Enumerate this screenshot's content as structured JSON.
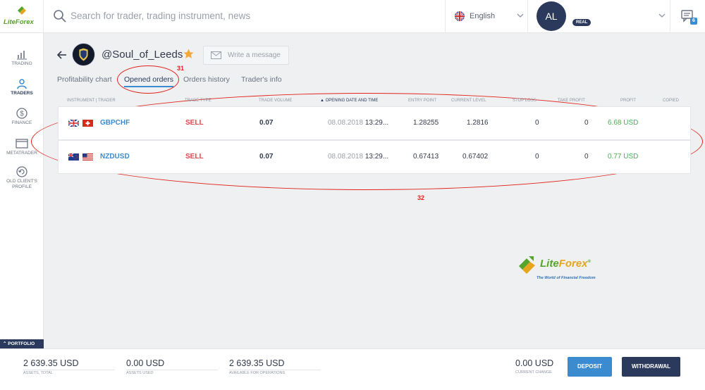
{
  "header": {
    "brand": "LiteForex",
    "search_placeholder": "Search for trader, trading instrument, news",
    "language": "English",
    "user_initials": "AL",
    "account_type": "REAL",
    "messages_count": "6"
  },
  "sidebar": {
    "items": [
      {
        "label": "TRADING",
        "icon": "chart-icon"
      },
      {
        "label": "TRADERS",
        "icon": "traders-icon"
      },
      {
        "label": "FINANCE",
        "icon": "dollar-icon"
      },
      {
        "label": "METATRADER",
        "icon": "window-icon"
      },
      {
        "label": "OLD CLIENT'S PROFILE",
        "icon": "refresh-icon"
      }
    ],
    "portfolio_label": "PORTFOLIO"
  },
  "trader": {
    "name": "@Soul_of_Leeds",
    "write_message": "Write a message"
  },
  "tabs": [
    {
      "label": "Profitability chart"
    },
    {
      "label": "Opened orders"
    },
    {
      "label": "Orders history"
    },
    {
      "label": "Trader's info"
    }
  ],
  "annotations": {
    "tab": "31",
    "table": "32"
  },
  "table": {
    "headers": [
      "INSTRUMENT | TRADER",
      "TRADE TYPE",
      "TRADE VOLUME",
      "OPENING DATE AND TIME",
      "ENTRY POINT",
      "CURRENT LEVEL",
      "STOP LOSS",
      "TAKE PROFIT",
      "PROFIT",
      "COPIED"
    ],
    "sort_indicator": "▲",
    "rows": [
      {
        "instrument": "GBPCHF",
        "type": "SELL",
        "volume": "0.07",
        "date": "08.08.2018",
        "time": "13:29...",
        "entry": "1.28255",
        "current": "1.2816",
        "stop_loss": "0",
        "take_profit": "0",
        "profit": "6.68 USD",
        "copied": ""
      },
      {
        "instrument": "NZDUSD",
        "type": "SELL",
        "volume": "0.07",
        "date": "08.08.2018",
        "time": "13:29...",
        "entry": "0.67413",
        "current": "0.67402",
        "stop_loss": "0",
        "take_profit": "0",
        "profit": "0.77 USD",
        "copied": ""
      }
    ]
  },
  "watermark": {
    "brand_lite": "Lite",
    "brand_forex": "Forex",
    "reg": "®",
    "tagline": "The World of Financial Freedom"
  },
  "footer": {
    "assets_total": {
      "value": "2 639.35 USD",
      "label": "ASSETS, TOTAL"
    },
    "assets_used": {
      "value": "0.00 USD",
      "label": "ASSETS USED"
    },
    "available": {
      "value": "2 639.35 USD",
      "label": "AVAILABLE FOR OPERATIONS"
    },
    "current_change": {
      "value": "0.00 USD",
      "label": "CURRENT CHANGE"
    },
    "deposit_label": "DEPOSIT",
    "withdrawal_label": "WITHDRAWAL"
  },
  "colors": {
    "accent": "#3b8bd1",
    "navy": "#2b3a5c",
    "sell": "#e2474d",
    "profit": "#4caf50",
    "annotation": "#e2231a"
  }
}
